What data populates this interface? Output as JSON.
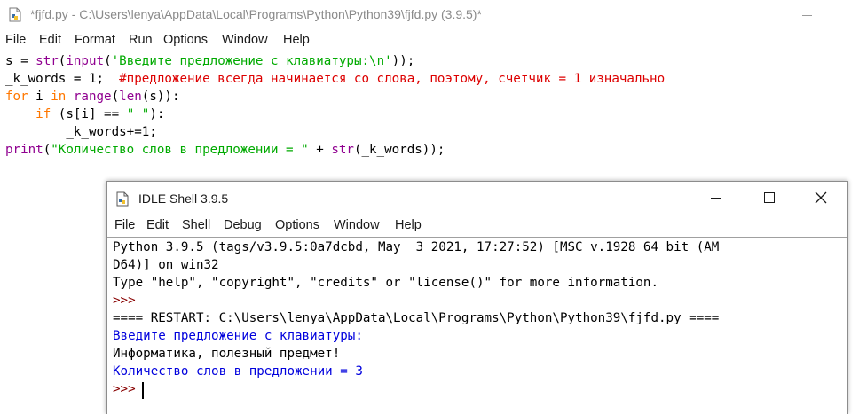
{
  "editor": {
    "title": "*fjfd.py - C:\\Users\\lenya\\AppData\\Local\\Programs\\Python\\Python39\\fjfd.py (3.9.5)*",
    "menu": [
      "File",
      "Edit",
      "Format",
      "Run",
      "Options",
      "Window",
      "Help"
    ],
    "code": [
      [
        {
          "t": "s = ",
          "c": "plain"
        },
        {
          "t": "str",
          "c": "builtin"
        },
        {
          "t": "(",
          "c": "plain"
        },
        {
          "t": "input",
          "c": "builtin"
        },
        {
          "t": "(",
          "c": "plain"
        },
        {
          "t": "'Введите предложение с клавиатуры:\\n'",
          "c": "string"
        },
        {
          "t": "));",
          "c": "plain"
        }
      ],
      [
        {
          "t": "_k_words = 1;  ",
          "c": "plain"
        },
        {
          "t": "#предложение всегда начинается со слова, поэтому, счетчик = 1 изначально",
          "c": "comment"
        }
      ],
      [
        {
          "t": "for",
          "c": "keyword"
        },
        {
          "t": " i ",
          "c": "plain"
        },
        {
          "t": "in",
          "c": "keyword"
        },
        {
          "t": " ",
          "c": "plain"
        },
        {
          "t": "range",
          "c": "builtin"
        },
        {
          "t": "(",
          "c": "plain"
        },
        {
          "t": "len",
          "c": "builtin"
        },
        {
          "t": "(s)):",
          "c": "plain"
        }
      ],
      [
        {
          "t": "    ",
          "c": "plain"
        },
        {
          "t": "if",
          "c": "keyword"
        },
        {
          "t": " (s[i] == ",
          "c": "plain"
        },
        {
          "t": "\" \"",
          "c": "string"
        },
        {
          "t": "):",
          "c": "plain"
        }
      ],
      [
        {
          "t": "        _k_words+=1;",
          "c": "plain"
        }
      ],
      [
        {
          "t": "print",
          "c": "builtin"
        },
        {
          "t": "(",
          "c": "plain"
        },
        {
          "t": "\"Количество слов в предложении = \"",
          "c": "string"
        },
        {
          "t": " + ",
          "c": "plain"
        },
        {
          "t": "str",
          "c": "builtin"
        },
        {
          "t": "(_k_words));",
          "c": "plain"
        }
      ]
    ]
  },
  "shell": {
    "title": "IDLE Shell 3.9.5",
    "menu": [
      "File",
      "Edit",
      "Shell",
      "Debug",
      "Options",
      "Window",
      "Help"
    ],
    "lines": [
      {
        "text": "Python 3.9.5 (tags/v3.9.5:0a7dcbd, May  3 2021, 17:27:52) [MSC v.1928 64 bit (AM",
        "style": "plain"
      },
      {
        "text": "D64)] on win32",
        "style": "plain"
      },
      {
        "text": "Type \"help\", \"copyright\", \"credits\" or \"license()\" for more information.",
        "style": "plain"
      },
      {
        "text": ">>> ",
        "style": "prompt"
      },
      {
        "text": "==== RESTART: C:\\Users\\lenya\\AppData\\Local\\Programs\\Python\\Python39\\fjfd.py ====",
        "style": "plain"
      },
      {
        "text": "Введите предложение с клавиатуры:",
        "style": "stdout"
      },
      {
        "text": "Информатика, полезный предмет!",
        "style": "user"
      },
      {
        "text": "Количество слов в предложении = 3",
        "style": "stdout"
      },
      {
        "text": ">>> ",
        "style": "prompt"
      }
    ]
  },
  "colors": {
    "keyword": "#ff7700",
    "builtin": "#900090",
    "string": "#00aa00",
    "comment": "#dd0000",
    "stdout": "#0000dd",
    "prompt": "#880000"
  }
}
